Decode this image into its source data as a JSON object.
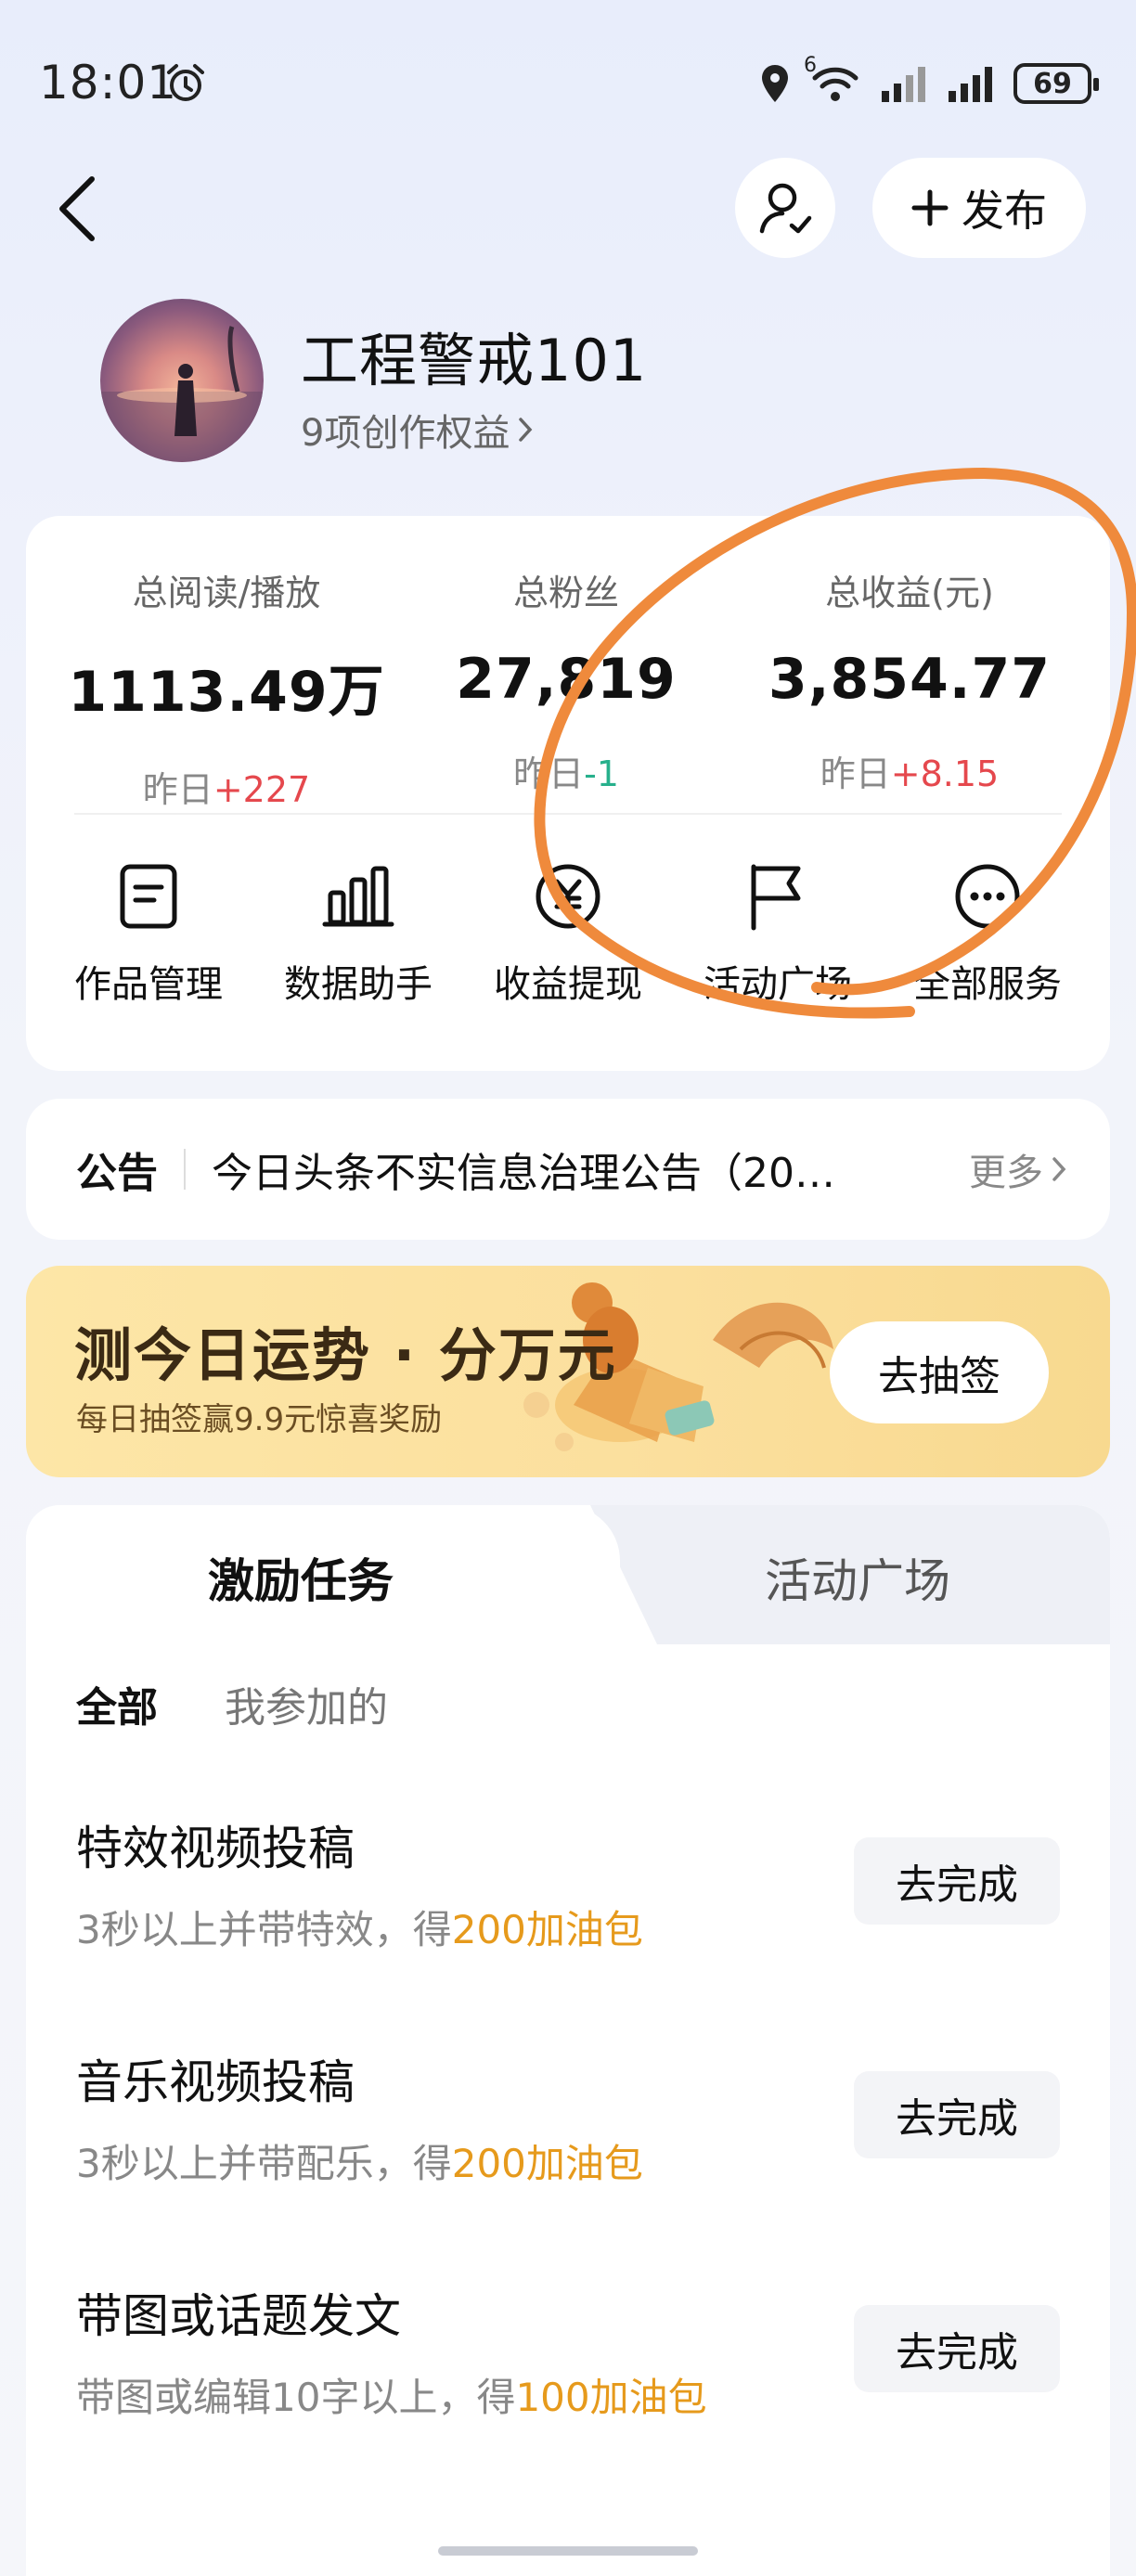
{
  "status_bar": {
    "time": "18:01",
    "network_label": "6",
    "battery": "69"
  },
  "header": {
    "back_icon": "chevron-left-icon",
    "user_icon": "user-settings-icon",
    "publish_label": "发布"
  },
  "profile": {
    "username": "工程警戒101",
    "rights_link": "9项创作权益"
  },
  "stats": [
    {
      "label": "总阅读/播放",
      "value": "1113.49万",
      "yesterday_prefix": "昨日",
      "yesterday_delta": "+227",
      "trend": "up"
    },
    {
      "label": "总粉丝",
      "value": "27,819",
      "yesterday_prefix": "昨日",
      "yesterday_delta": "-1",
      "trend": "down"
    },
    {
      "label": "总收益(元)",
      "value": "3,854.77",
      "yesterday_prefix": "昨日",
      "yesterday_delta": "+8.15",
      "trend": "up"
    }
  ],
  "tools": [
    {
      "label": "作品管理",
      "icon": "document-icon"
    },
    {
      "label": "数据助手",
      "icon": "bar-chart-icon"
    },
    {
      "label": "收益提现",
      "icon": "yuan-coin-icon"
    },
    {
      "label": "活动广场",
      "icon": "flag-icon"
    },
    {
      "label": "全部服务",
      "icon": "more-dots-icon"
    }
  ],
  "notice": {
    "tag": "公告",
    "text": "今日头条不实信息治理公告（20…",
    "more": "更多"
  },
  "banner": {
    "title": "测今日运势 · 分万元",
    "subtitle": "每日抽签赢9.9元惊喜奖励",
    "button": "去抽签"
  },
  "tasks_panel": {
    "tabs": [
      "激励任务",
      "活动广场"
    ],
    "active_tab": "激励任务",
    "filters": [
      "全部",
      "我参加的"
    ],
    "active_filter": "全部",
    "items": [
      {
        "title": "特效视频投稿",
        "desc_prefix": "3秒以上并带特效，得",
        "reward": "200加油包",
        "button": "去完成"
      },
      {
        "title": "音乐视频投稿",
        "desc_prefix": "3秒以上并带配乐，得",
        "reward": "200加油包",
        "button": "去完成"
      },
      {
        "title": "带图或话题发文",
        "desc_prefix": "带图或编辑10字以上，得",
        "reward": "100加油包",
        "button": "去完成"
      }
    ]
  },
  "colors": {
    "up": "#e5484d",
    "down": "#27b08c",
    "reward": "#e69a1c",
    "annotation": "#ef8a3c",
    "banner_bg": "#fbdf9d"
  }
}
